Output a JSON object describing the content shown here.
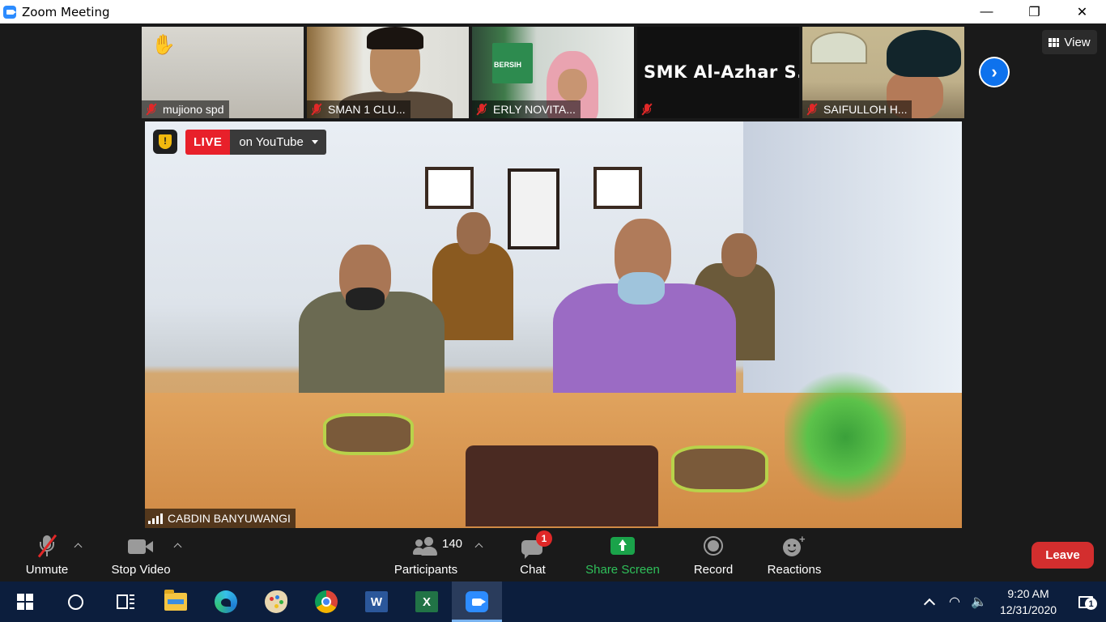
{
  "window": {
    "title": "Zoom Meeting",
    "minimize": "—",
    "restore": "❐",
    "close": "✕"
  },
  "gallery": {
    "tiles": [
      {
        "name": "mujiono spd",
        "muted": true,
        "raised_hand": true
      },
      {
        "name": "SMAN 1 CLU...",
        "muted": true
      },
      {
        "name": "ERLY NOVITA...",
        "muted": true
      },
      {
        "name": "",
        "display_name": "SMK Al-Azhar S...",
        "muted": true
      },
      {
        "name": "SAIFULLOH H...",
        "muted": true
      }
    ],
    "next_icon": "›",
    "view_label": "View",
    "board_text": "BERSIH"
  },
  "main_video": {
    "live_label": "LIVE",
    "stream_label": "on YouTube",
    "security_glyph": "!",
    "speaker_name": "CABDIN BANYUWANGI"
  },
  "controls": {
    "unmute": "Unmute",
    "stop_video": "Stop Video",
    "participants": "Participants",
    "participants_count": "140",
    "chat": "Chat",
    "chat_badge": "1",
    "share_screen": "Share Screen",
    "record": "Record",
    "reactions": "Reactions",
    "leave": "Leave",
    "share_color": "#1aa34a",
    "leave_color": "#d32e2e"
  },
  "taskbar": {
    "apps": [
      "start",
      "search",
      "task-view",
      "file-explorer",
      "edge",
      "paint",
      "chrome",
      "word",
      "excel",
      "zoom"
    ],
    "word_letter": "W",
    "excel_letter": "X",
    "time": "9:20 AM",
    "date": "12/31/2020",
    "notification_count": "1",
    "wifi_glyph": "◠",
    "volume_glyph": "🔈"
  }
}
